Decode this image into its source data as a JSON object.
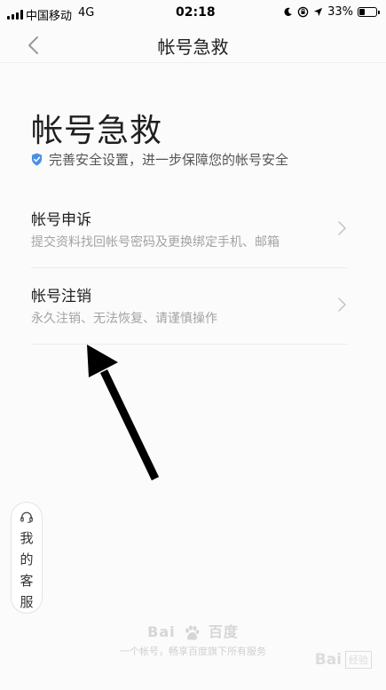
{
  "status_bar": {
    "carrier": "中国移动",
    "network": "4G",
    "time": "02:18",
    "battery_percent": "33%",
    "battery_level": 0.33,
    "icons": [
      "moon-icon",
      "lock-rotation-icon",
      "location-icon"
    ]
  },
  "nav": {
    "title": "帐号急救",
    "back_icon": "chevron-left-icon"
  },
  "header": {
    "title": "帐号急救",
    "subtitle": "完善安全设置，进一步保障您的帐号安全",
    "shield_color": "#4a90e2"
  },
  "options": [
    {
      "title": "帐号申诉",
      "description": "提交资料找回帐号密码及更换绑定手机、邮箱"
    },
    {
      "title": "帐号注销",
      "description": "永久注销、无法恢复、请谨慎操作"
    }
  ],
  "service": {
    "label": "我的客服",
    "icon": "headset-icon"
  },
  "footer": {
    "logo_left": "Bai",
    "logo_right": "百度",
    "text": "一个帐号，畅享百度旗下所有服务"
  },
  "watermark": {
    "brand": "Bai",
    "box": "经验"
  }
}
